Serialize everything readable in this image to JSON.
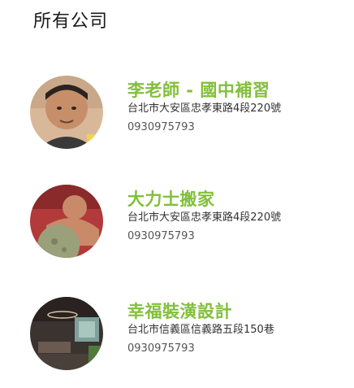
{
  "header": {
    "title": "所有公司"
  },
  "companies": [
    {
      "name": "李老師 - 國中補習",
      "address": "台北市大安區忠孝東路4段220號",
      "phone": "0930975793"
    },
    {
      "name": "大力士搬家",
      "address": "台北市大安區忠孝東路4段220號",
      "phone": "0930975793"
    },
    {
      "name": "幸福裝潢設計",
      "address": "台北市信義區信義路五段150巷",
      "phone": "0930975793"
    }
  ],
  "colors": {
    "accent": "#82bf3c",
    "text": "#333333",
    "title": "#1a1a1a"
  }
}
